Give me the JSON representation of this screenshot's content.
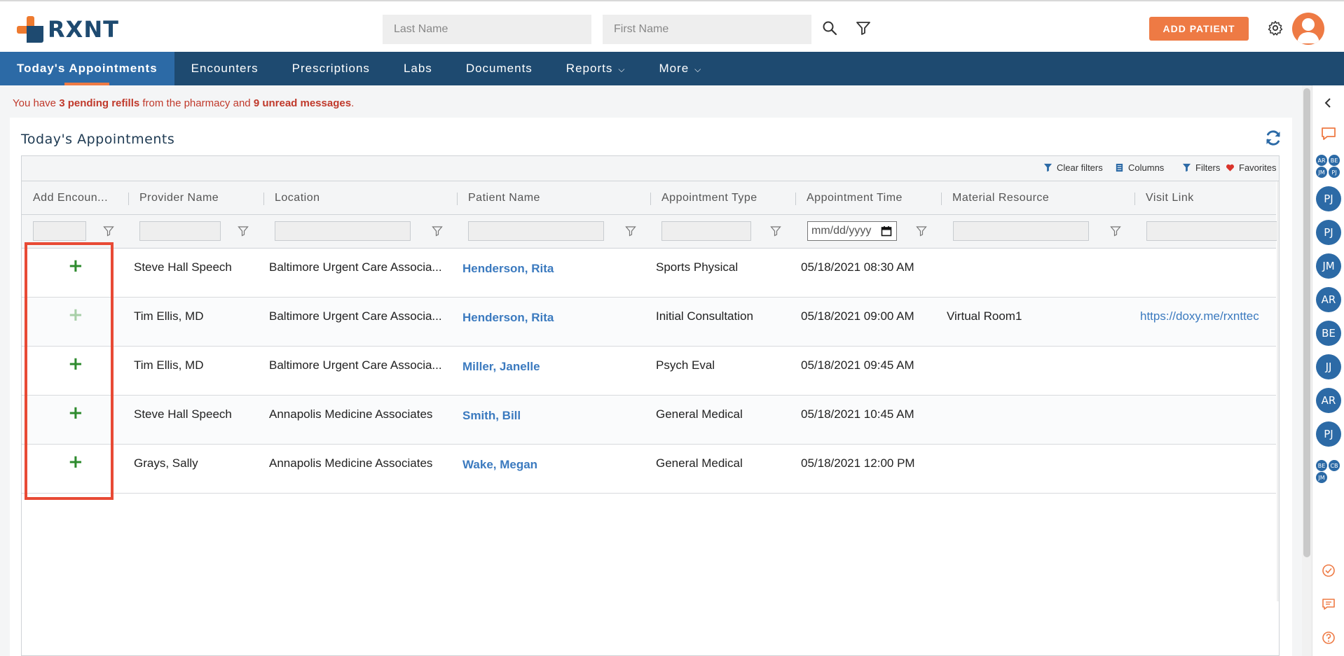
{
  "brand": {
    "name": "RXNT"
  },
  "search": {
    "last_name_placeholder": "Last Name",
    "first_name_placeholder": "First Name"
  },
  "header": {
    "add_patient_label": "ADD PATIENT"
  },
  "nav": {
    "items": [
      {
        "label": "Today's Appointments"
      },
      {
        "label": "Encounters"
      },
      {
        "label": "Prescriptions"
      },
      {
        "label": "Labs"
      },
      {
        "label": "Documents"
      },
      {
        "label": "Reports"
      },
      {
        "label": "More"
      }
    ]
  },
  "alert": {
    "prefix": "You have",
    "refills": "3 pending refills",
    "middle": "from the pharmacy and",
    "messages": "9 unread messages",
    "suffix": "."
  },
  "panel": {
    "title": "Today's Appointments"
  },
  "toolbar": {
    "clear_filters": "Clear filters",
    "columns": "Columns",
    "filters": "Filters",
    "favorites": "Favorites"
  },
  "columns": [
    "Add Encoun...",
    "Provider Name",
    "Location",
    "Patient Name",
    "Appointment Type",
    "Appointment Time",
    "Material Resource",
    "Visit Link"
  ],
  "date_filter_placeholder": "mm/dd/yyyy",
  "rows": [
    {
      "provider": "Steve Hall Speech",
      "location": "Baltimore Urgent Care Associa...",
      "patient": "Henderson, Rita",
      "type": "Sports Physical",
      "time": "05/18/2021 08:30 AM",
      "resource": "",
      "link": ""
    },
    {
      "provider": "Tim Ellis, MD",
      "location": "Baltimore Urgent Care Associa...",
      "patient": "Henderson, Rita",
      "type": "Initial Consultation",
      "time": "05/18/2021 09:00 AM",
      "resource": "Virtual Room1",
      "link": "https://doxy.me/rxnttec"
    },
    {
      "provider": "Tim Ellis, MD",
      "location": "Baltimore Urgent Care Associa...",
      "patient": "Miller, Janelle",
      "type": "Psych Eval",
      "time": "05/18/2021 09:45 AM",
      "resource": "",
      "link": ""
    },
    {
      "provider": "Steve Hall Speech",
      "location": "Annapolis Medicine Associates",
      "patient": "Smith, Bill",
      "type": "General Medical",
      "time": "05/18/2021 10:45 AM",
      "resource": "",
      "link": ""
    },
    {
      "provider": "Grays, Sally",
      "location": "Annapolis Medicine Associates",
      "patient": "Wake, Megan",
      "type": "General Medical",
      "time": "05/18/2021 12:00 PM",
      "resource": "",
      "link": ""
    }
  ],
  "add_symbol": "+",
  "rail": {
    "group1": [
      "AR",
      "BE",
      "JM",
      "PJ"
    ],
    "bubbles": [
      "PJ",
      "PJ",
      "JM",
      "AR",
      "BE",
      "JJ",
      "AR",
      "PJ"
    ],
    "group2": [
      "BE",
      "CB",
      "JM"
    ]
  },
  "colors": {
    "nav_bg": "#1e4a70",
    "nav_active": "#2c6aa6",
    "accent": "#ee7a44",
    "link": "#3b7abf",
    "alert": "#c0392b",
    "add_icon": "#2e8b2e"
  }
}
